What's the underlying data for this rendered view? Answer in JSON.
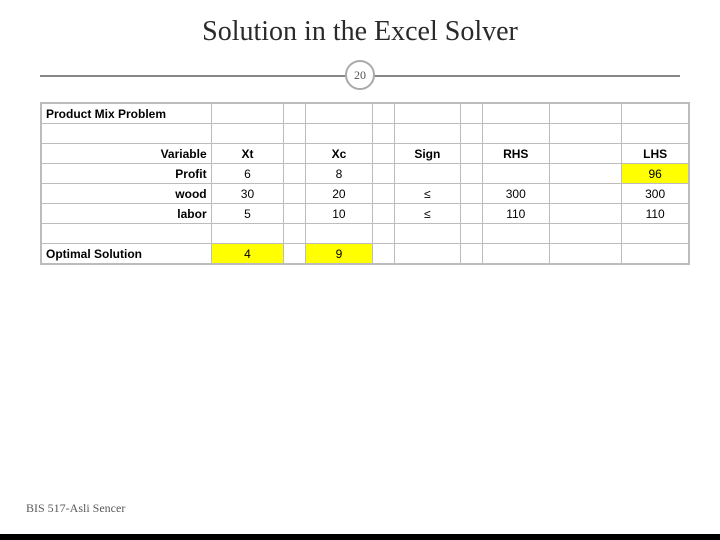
{
  "title": "Solution in the Excel Solver",
  "slide_number": "20",
  "footer": "BIS 517-Asli Sencer",
  "sheet": {
    "heading": "Product Mix Problem",
    "cols": {
      "variable": "Variable",
      "xt": "Xt",
      "xc": "Xc",
      "sign": "Sign",
      "rhs": "RHS",
      "lhs": "LHS"
    },
    "rows": {
      "profit": {
        "label": "Profit",
        "xt": "6",
        "xc": "8",
        "lhs": "96"
      },
      "wood": {
        "label": "wood",
        "xt": "30",
        "xc": "20",
        "sign": "≤",
        "rhs": "300",
        "lhs": "300"
      },
      "labor": {
        "label": "labor",
        "xt": "5",
        "xc": "10",
        "sign": "≤",
        "rhs": "110",
        "lhs": "110"
      }
    },
    "optimal": {
      "label": "Optimal Solution",
      "xt": "4",
      "xc": "9"
    }
  }
}
